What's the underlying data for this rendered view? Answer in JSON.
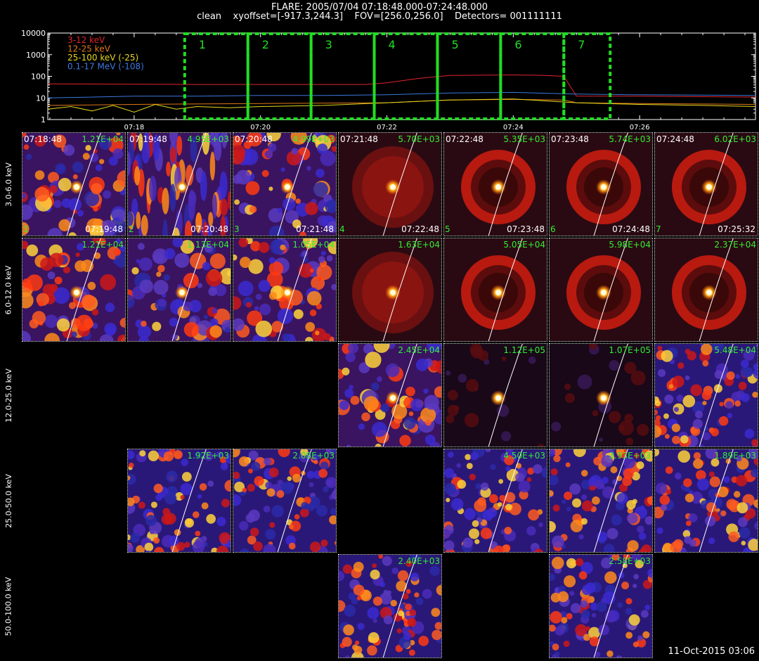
{
  "header": {
    "line1": "FLARE: 2005/07/04 07:18:48.000-07:24:48.000",
    "line2": "clean    xyoffset=[-917.3,244.3]    FOV=[256.0,256.0]    Detectors= 001111111"
  },
  "chart_data": {
    "type": "line",
    "yscale": "log",
    "ylim": [
      1,
      10000
    ],
    "yticks": [
      "1",
      "10",
      "100",
      "1000",
      "10000"
    ],
    "xlim": [
      "07:16:38",
      "07:27:50"
    ],
    "xticks": [
      "07:18",
      "07:20",
      "07:22",
      "07:24",
      "07:26"
    ],
    "legend": [
      {
        "label": "3-12 keV",
        "color": "#e0242c"
      },
      {
        "label": "12-25 keV",
        "color": "#e07818"
      },
      {
        "label": "25-100 keV (-25)",
        "color": "#e6d81c"
      },
      {
        "label": "0.1-17 MeV (-108)",
        "color": "#3c78dc"
      }
    ],
    "series": [
      {
        "name": "3-12 keV",
        "color": "#e0242c",
        "x": [
          "07:16:38",
          "07:18:00",
          "07:19:00",
          "07:20:00",
          "07:21:00",
          "07:21:40",
          "07:22:00",
          "07:22:30",
          "07:23:00",
          "07:24:00",
          "07:24:30",
          "07:24:48",
          "07:25:00",
          "07:26:00",
          "07:27:50"
        ],
        "y": [
          45,
          43,
          42,
          42,
          42,
          42,
          50,
          80,
          110,
          115,
          110,
          100,
          12,
          12,
          11
        ]
      },
      {
        "name": "12-25 keV",
        "color": "#e07818",
        "x": [
          "07:16:38",
          "07:18:00",
          "07:20:00",
          "07:22:00",
          "07:23:00",
          "07:24:00",
          "07:24:48",
          "07:25:00",
          "07:26:00",
          "07:27:50"
        ],
        "y": [
          4.5,
          5,
          5.5,
          6,
          8,
          8.5,
          8,
          6,
          5.5,
          5
        ]
      },
      {
        "name": "25-100 keV (-25)",
        "color": "#e6d81c",
        "x": [
          "07:16:38",
          "07:17:00",
          "07:17:20",
          "07:17:40",
          "07:18:00",
          "07:18:20",
          "07:18:40",
          "07:19:00",
          "07:19:30",
          "07:20:00",
          "07:21:00",
          "07:22:00",
          "07:23:00",
          "07:24:00",
          "07:25:00",
          "07:26:00",
          "07:27:00",
          "07:27:50"
        ],
        "y": [
          3,
          4,
          2.5,
          4.5,
          2.2,
          5,
          3,
          4,
          3.5,
          4,
          4.5,
          6,
          8,
          9,
          6,
          5,
          4.5,
          4
        ]
      },
      {
        "name": "0.1-17 MeV (-108)",
        "color": "#3c78dc",
        "x": [
          "07:16:38",
          "07:18:00",
          "07:19:00",
          "07:20:00",
          "07:21:00",
          "07:22:00",
          "07:23:00",
          "07:24:00",
          "07:25:00",
          "07:26:00",
          "07:27:50"
        ],
        "y": [
          10,
          12,
          12,
          13,
          13,
          14,
          17,
          18,
          15,
          14,
          13
        ]
      }
    ],
    "intervals": [
      {
        "label": "1",
        "start": "07:18:48",
        "end": "07:19:48"
      },
      {
        "label": "2",
        "start": "07:19:48",
        "end": "07:20:48"
      },
      {
        "label": "3",
        "start": "07:20:48",
        "end": "07:21:48"
      },
      {
        "label": "4",
        "start": "07:21:48",
        "end": "07:22:48"
      },
      {
        "label": "5",
        "start": "07:22:48",
        "end": "07:23:48"
      },
      {
        "label": "6",
        "start": "07:23:48",
        "end": "07:24:48"
      },
      {
        "label": "7",
        "start": "07:24:48",
        "end": "07:25:32"
      }
    ],
    "interval_color": "#22dd22"
  },
  "grid": {
    "rows": [
      "3.0-6.0 keV",
      "6.0-12.0 keV",
      "12.0-25.0 keV",
      "25.0-50.0 keV",
      "50.0-100.0 keV"
    ],
    "columns": [
      {
        "start": "07:18:48",
        "end": "07:19:48",
        "index": "1"
      },
      {
        "start": "07:19:48",
        "end": "07:20:48",
        "index": "2"
      },
      {
        "start": "07:20:48",
        "end": "07:21:48",
        "index": "3"
      },
      {
        "start": "07:21:48",
        "end": "07:22:48",
        "index": "4"
      },
      {
        "start": "07:22:48",
        "end": "07:23:48",
        "index": "5"
      },
      {
        "start": "07:23:48",
        "end": "07:24:48",
        "index": "6"
      },
      {
        "start": "07:24:48",
        "end": "07:25:32",
        "index": "7"
      }
    ],
    "images": [
      {
        "row": 0,
        "col": 0,
        "max": "1.21E+04",
        "style": "patchy"
      },
      {
        "row": 0,
        "col": 1,
        "max": "4.95E+03",
        "style": "striped"
      },
      {
        "row": 0,
        "col": 2,
        "max": "4.99E+03",
        "style": "patchy"
      },
      {
        "row": 0,
        "col": 3,
        "max": "5.70E+03",
        "style": "disk"
      },
      {
        "row": 0,
        "col": 4,
        "max": "5.35E+03",
        "style": "ring"
      },
      {
        "row": 0,
        "col": 5,
        "max": "5.74E+03",
        "style": "ring"
      },
      {
        "row": 0,
        "col": 6,
        "max": "6.02E+03",
        "style": "ring"
      },
      {
        "row": 1,
        "col": 0,
        "max": "1.21E+04",
        "style": "patchy"
      },
      {
        "row": 1,
        "col": 1,
        "max": "1.13E+04",
        "style": "patchy"
      },
      {
        "row": 1,
        "col": 2,
        "max": "1.05E+04",
        "style": "patchy"
      },
      {
        "row": 1,
        "col": 3,
        "max": "1.63E+04",
        "style": "disk"
      },
      {
        "row": 1,
        "col": 4,
        "max": "5.05E+04",
        "style": "ring"
      },
      {
        "row": 1,
        "col": 5,
        "max": "5.98E+04",
        "style": "ring"
      },
      {
        "row": 1,
        "col": 6,
        "max": "2.37E+04",
        "style": "ring"
      },
      {
        "row": 2,
        "col": 3,
        "max": "2.45E+04",
        "style": "mottled"
      },
      {
        "row": 2,
        "col": 4,
        "max": "1.12E+05",
        "style": "point"
      },
      {
        "row": 2,
        "col": 5,
        "max": "1.07E+05",
        "style": "point"
      },
      {
        "row": 2,
        "col": 6,
        "max": "5.48E+04",
        "style": "noisy"
      },
      {
        "row": 3,
        "col": 1,
        "max": "1.92E+03",
        "style": "noisy"
      },
      {
        "row": 3,
        "col": 2,
        "max": "2.08E+03",
        "style": "noisy"
      },
      {
        "row": 3,
        "col": 4,
        "max": "4.50E+03",
        "style": "noisy"
      },
      {
        "row": 3,
        "col": 5,
        "max": "3.93E+03",
        "style": "noisy"
      },
      {
        "row": 3,
        "col": 6,
        "max": "1.89E+03",
        "style": "noisy"
      },
      {
        "row": 4,
        "col": 3,
        "max": "2.40E+03",
        "style": "noisy"
      },
      {
        "row": 4,
        "col": 5,
        "max": "2.58E+03",
        "style": "noisy"
      }
    ]
  },
  "footer": "11-Oct-2015 03:06"
}
